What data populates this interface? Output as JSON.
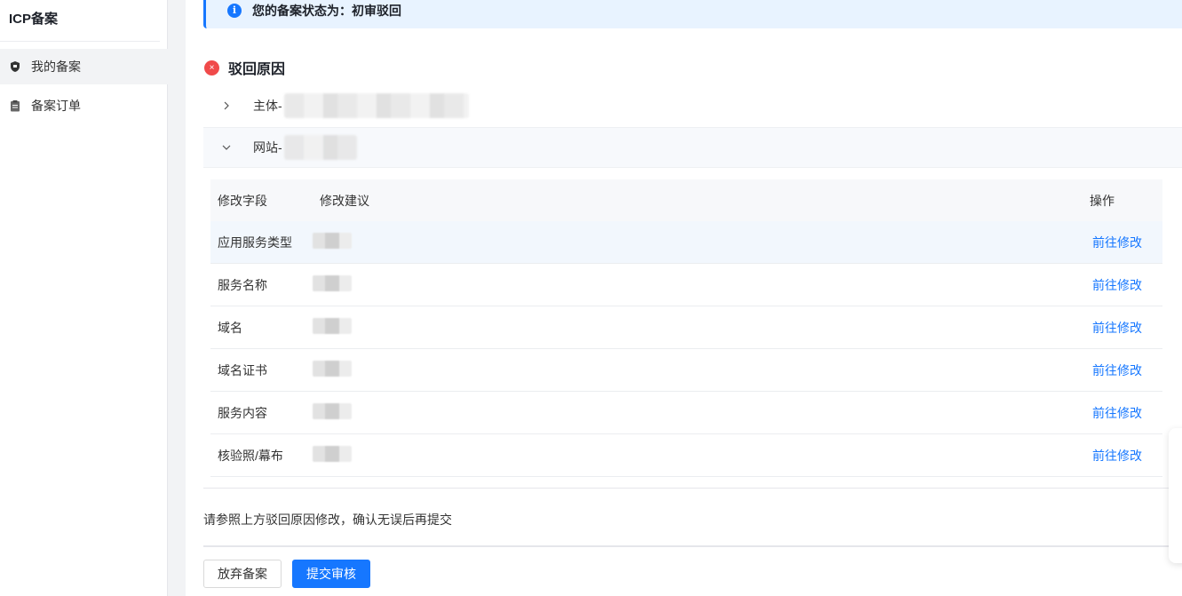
{
  "sidebar": {
    "title": "ICP备案",
    "items": [
      {
        "label": "我的备案",
        "icon": "shield-icon"
      },
      {
        "label": "备案订单",
        "icon": "clipboard-icon"
      }
    ]
  },
  "alert": {
    "text": "您的备案状态为：初审驳回",
    "icon": "info-icon"
  },
  "reason": {
    "title": "驳回原因",
    "icon": "error-x-icon"
  },
  "collapse": [
    {
      "label": "主体-",
      "expanded": false
    },
    {
      "label": "网站-",
      "expanded": true
    }
  ],
  "table": {
    "headers": [
      "修改字段",
      "修改建议",
      "操作"
    ],
    "rows": [
      {
        "field": "应用服务类型",
        "action": "前往修改"
      },
      {
        "field": "服务名称",
        "action": "前往修改"
      },
      {
        "field": "域名",
        "action": "前往修改"
      },
      {
        "field": "域名证书",
        "action": "前往修改"
      },
      {
        "field": "服务内容",
        "action": "前往修改"
      },
      {
        "field": "核验照/幕布",
        "action": "前往修改"
      }
    ]
  },
  "hint": "请参照上方驳回原因修改，确认无误后再提交",
  "buttons": {
    "abandon": "放弃备案",
    "submit": "提交审核"
  },
  "colors": {
    "primary": "#1677ff",
    "error": "#f04a4a",
    "alert_bg": "#e8f3ff"
  }
}
